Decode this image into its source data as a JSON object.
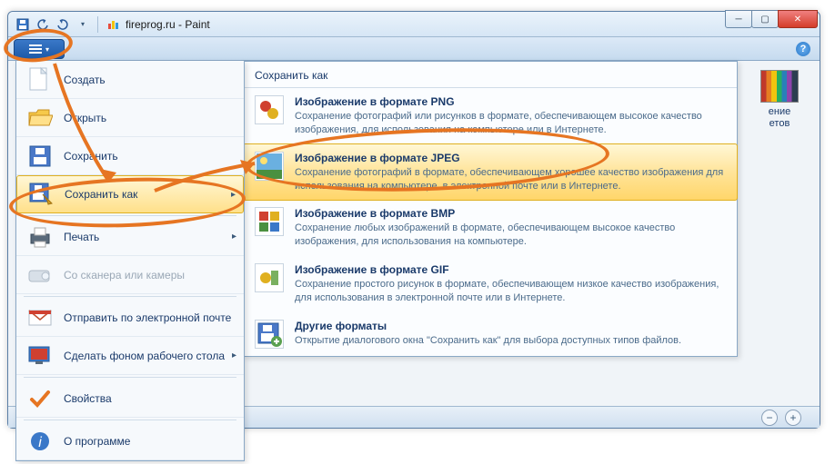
{
  "title": "fireprog.ru - Paint",
  "right_peek": {
    "line1": "ение",
    "line2": "етов"
  },
  "menu": {
    "create": "Создать",
    "open": "Открыть",
    "save": "Сохранить",
    "save_as": "Сохранить как",
    "print": "Печать",
    "scanner": "Со сканера или камеры",
    "send": "Отправить по электронной почте",
    "wallpaper": "Сделать фоном рабочего стола",
    "properties": "Свойства",
    "about": "О программе"
  },
  "submenu": {
    "header": "Сохранить как",
    "items": [
      {
        "title": "Изображение в формате PNG",
        "desc": "Сохранение фотографий или рисунков в формате, обеспечивающем высокое качество изображения, для использования на компьютере или в Интернете."
      },
      {
        "title": "Изображение в формате JPEG",
        "desc": "Сохранение фотографий в формате, обеспечивающем хорошее качество изображения для использования на компьютере, в электронной почте или в Интернете."
      },
      {
        "title": "Изображение в формате BMP",
        "desc": "Сохранение любых изображений в формате, обеспечивающем высокое качество изображения, для использования на компьютере."
      },
      {
        "title": "Изображение в формате GIF",
        "desc": "Сохранение простого рисунок в формате, обеспечивающем низкое качество изображения, для использования в электронной почте или в Интернете."
      },
      {
        "title": "Другие форматы",
        "desc": "Открытие диалогового окна \"Сохранить как\" для выбора доступных типов файлов."
      }
    ]
  }
}
